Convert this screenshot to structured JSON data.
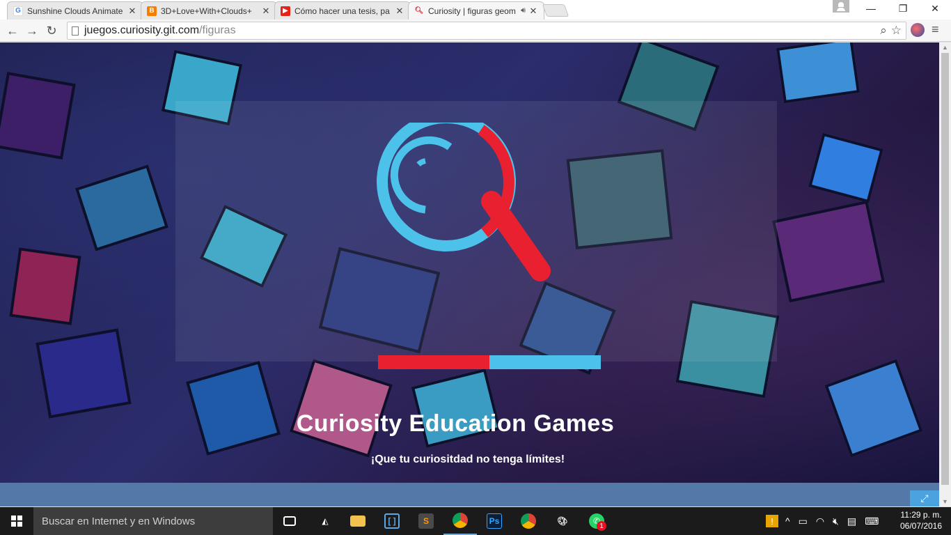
{
  "browser": {
    "tabs": [
      {
        "title": "Sunshine Clouds Animate",
        "favicon": "google-icon",
        "color": "#4285f4",
        "active": false
      },
      {
        "title": "3D+Love+With+Clouds+",
        "favicon": "blogger-icon",
        "color": "#f57d00",
        "active": false
      },
      {
        "title": "Cómo hacer una tesis, pa",
        "favicon": "youtube-icon",
        "color": "#e62117",
        "active": false
      },
      {
        "title": "Curiosity | figuras geom",
        "favicon": "magnifier-icon",
        "color": "#e8202f",
        "active": true
      }
    ],
    "address": {
      "host": "juegos.curiosity.git.com",
      "path": "/figuras"
    },
    "window_controls": {
      "minimize": "—",
      "restore": "❐",
      "close": "✕"
    }
  },
  "page": {
    "title": "Curiosity Education Games",
    "subtitle": "¡Que tu curiositdad no tenga límites!",
    "progress": 0.5,
    "colors": {
      "accent_red": "#e8202f",
      "accent_blue": "#4cc1ea",
      "footer": "#5479a8"
    }
  },
  "taskbar": {
    "search_placeholder": "Buscar en Internet y en Windows",
    "apps": [
      {
        "name": "task-view-icon",
        "running": false
      },
      {
        "name": "unity-icon",
        "running": false
      },
      {
        "name": "file-explorer-icon",
        "running": false
      },
      {
        "name": "brackets-icon",
        "running": false
      },
      {
        "name": "sublime-text-icon",
        "running": false
      },
      {
        "name": "chrome-icon",
        "running": true
      },
      {
        "name": "photoshop-icon",
        "running": false
      },
      {
        "name": "chrome-icon",
        "running": false
      },
      {
        "name": "paint-icon",
        "running": false
      },
      {
        "name": "whatsapp-icon",
        "running": false,
        "badge": "1"
      }
    ],
    "clock": {
      "time": "11:29 p. m.",
      "date": "06/07/2016"
    }
  }
}
